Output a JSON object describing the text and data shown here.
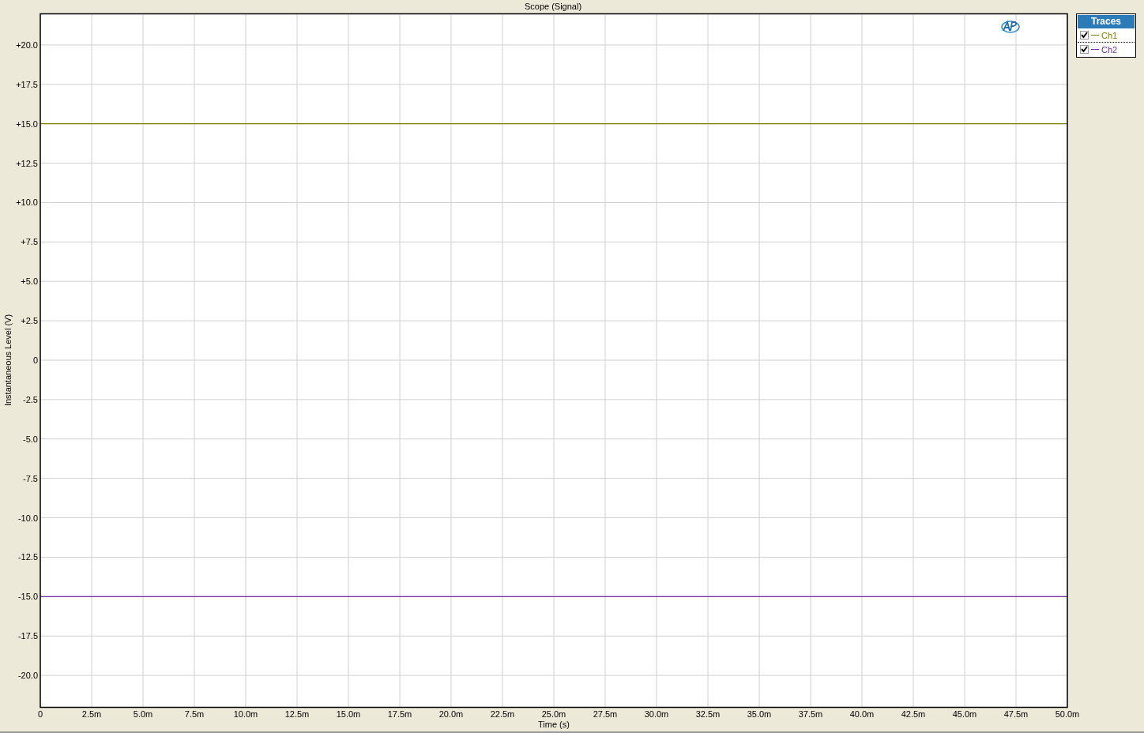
{
  "window": {
    "title": "Scope (Signal)"
  },
  "chart": {
    "chart_data": {
      "type": "line",
      "xlabel": "Time (s)",
      "ylabel": "Instantaneous Level (V)",
      "x": [
        0,
        50
      ],
      "series": [
        {
          "name": "Ch1",
          "color": "#808000",
          "values": [
            15,
            15
          ]
        },
        {
          "name": "Ch2",
          "color": "#7030a0",
          "values": [
            -15,
            -15
          ]
        }
      ],
      "xlim": [
        0,
        50
      ],
      "ylim": [
        -22,
        22
      ],
      "grid": true,
      "xticks": [
        {
          "value": 0,
          "label": "0"
        },
        {
          "value": 2.5,
          "label": "2.5m"
        },
        {
          "value": 5,
          "label": "5.0m"
        },
        {
          "value": 7.5,
          "label": "7.5m"
        },
        {
          "value": 10,
          "label": "10.0m"
        },
        {
          "value": 12.5,
          "label": "12.5m"
        },
        {
          "value": 15,
          "label": "15.0m"
        },
        {
          "value": 17.5,
          "label": "17.5m"
        },
        {
          "value": 20,
          "label": "20.0m"
        },
        {
          "value": 22.5,
          "label": "22.5m"
        },
        {
          "value": 25,
          "label": "25.0m"
        },
        {
          "value": 27.5,
          "label": "27.5m"
        },
        {
          "value": 30,
          "label": "30.0m"
        },
        {
          "value": 32.5,
          "label": "32.5m"
        },
        {
          "value": 35,
          "label": "35.0m"
        },
        {
          "value": 37.5,
          "label": "37.5m"
        },
        {
          "value": 40,
          "label": "40.0m"
        },
        {
          "value": 42.5,
          "label": "42.5m"
        },
        {
          "value": 45,
          "label": "45.0m"
        },
        {
          "value": 47.5,
          "label": "47.5m"
        },
        {
          "value": 50,
          "label": "50.0m"
        }
      ],
      "yticks": [
        {
          "value": 20,
          "label": "+20.0"
        },
        {
          "value": 17.5,
          "label": "+17.5"
        },
        {
          "value": 15,
          "label": "+15.0"
        },
        {
          "value": 12.5,
          "label": "+12.5"
        },
        {
          "value": 10,
          "label": "+10.0"
        },
        {
          "value": 7.5,
          "label": "+7.5"
        },
        {
          "value": 5,
          "label": "+5.0"
        },
        {
          "value": 2.5,
          "label": "+2.5"
        },
        {
          "value": 0,
          "label": "0"
        },
        {
          "value": -2.5,
          "label": "-2.5"
        },
        {
          "value": -5,
          "label": "-5.0"
        },
        {
          "value": -7.5,
          "label": "-7.5"
        },
        {
          "value": -10,
          "label": "-10.0"
        },
        {
          "value": -12.5,
          "label": "-12.5"
        },
        {
          "value": -15,
          "label": "-15.0"
        },
        {
          "value": -17.5,
          "label": "-17.5"
        },
        {
          "value": -20,
          "label": "-20.0"
        }
      ]
    }
  },
  "legend": {
    "title": "Traces",
    "items": [
      {
        "checked": true
      },
      {
        "checked": true
      }
    ]
  }
}
